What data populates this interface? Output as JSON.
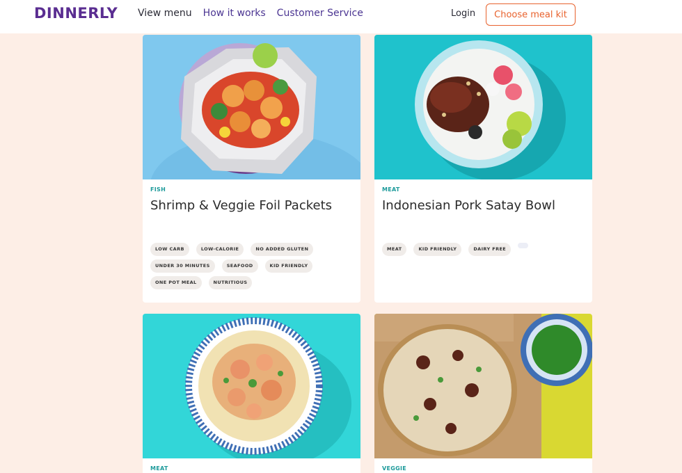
{
  "header": {
    "logo": "DINNERLY",
    "nav": [
      "View menu",
      "How it works",
      "Customer Service"
    ],
    "login": "Login",
    "cta": "Choose meal kit"
  },
  "cards": [
    {
      "category": "FISH",
      "title": "Shrimp & Veggie Foil Packets",
      "tags": [
        "LOW CARB",
        "LOW-CALORIE",
        "NO ADDED GLUTEN",
        "UNDER 30 MINUTES",
        "SEAFOOD",
        "KID FRIENDLY",
        "ONE POT MEAL",
        "NUTRITIOUS"
      ]
    },
    {
      "category": "MEAT",
      "title": "Indonesian Pork Satay Bowl",
      "tags": [
        "MEAT",
        "KID FRIENDLY",
        "DAIRY FREE"
      ]
    },
    {
      "category": "MEAT",
      "title": "",
      "tags": []
    },
    {
      "category": "VEGGIE",
      "title": "",
      "tags": []
    }
  ],
  "colors": {
    "brand": "#5a2d91",
    "accent": "#e8622d",
    "category": "#1c9a9a",
    "page_bg": "#fdeee6"
  }
}
